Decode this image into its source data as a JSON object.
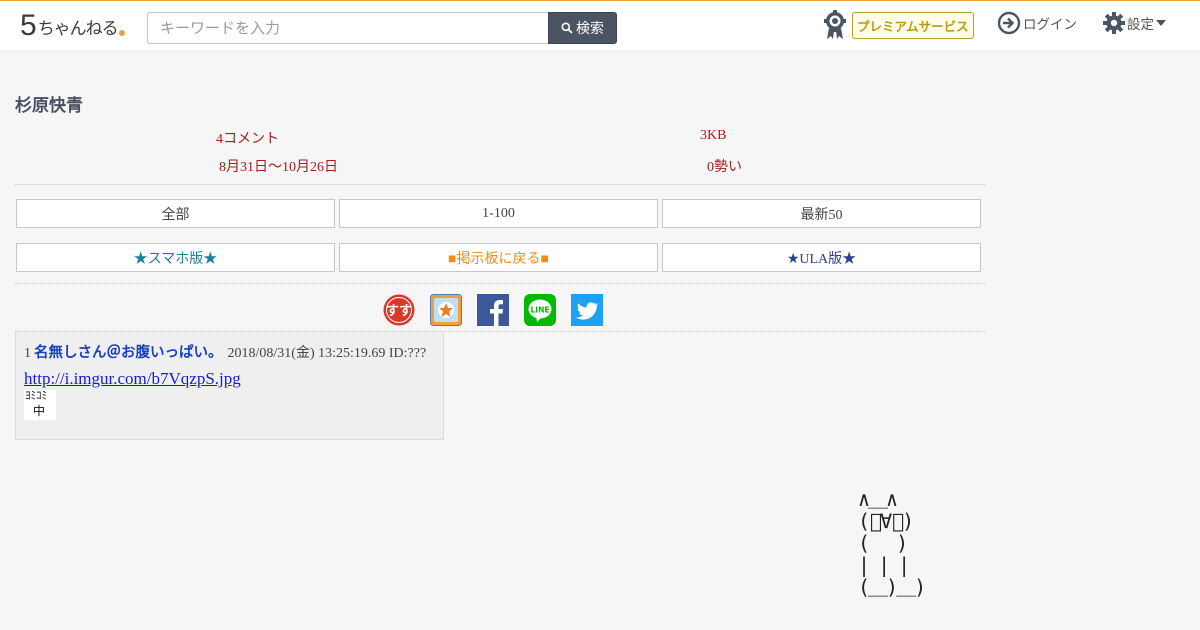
{
  "header": {
    "logo_five": "5",
    "logo_text": "ちゃんねる",
    "search_placeholder": "キーワードを入力",
    "search_button": "検索",
    "premium_label": "プレミアムサービス",
    "login_label": "ログイン",
    "settings_label": "設定"
  },
  "thread": {
    "title": "杉原快青",
    "comments": "4コメント",
    "size": "3KB",
    "dates": "8月31日〜10月26日",
    "momentum": "0勢い"
  },
  "nav": {
    "row1": [
      "全部",
      "1-100",
      "最新50"
    ],
    "row2": [
      "★スマホ版★",
      "■掲示板に戻る■",
      "★ULA版★"
    ]
  },
  "share": [
    "sukusuku-icon",
    "bookmark-icon",
    "facebook-icon",
    "line-icon",
    "twitter-icon"
  ],
  "post": {
    "number": "1",
    "name": "名無しさん＠お腹いっぱい。",
    "date": "2018/08/31(金) 13:25:19.69 ID:???",
    "link": "http://i.imgur.com/b7VqzpS.jpg",
    "image_line1": "ﾖﾐｺﾐ",
    "image_line2": "中"
  },
  "ascii_art": "∧＿∧\n(ﾟ∀ﾟ)\n(　 )\n| | |\n(＿)＿)",
  "colors": {
    "accent": "#e8a23a",
    "meta_red": "#a32020",
    "post_name_blue": "#1a3fc4",
    "link_blue": "#1a1ad6"
  }
}
